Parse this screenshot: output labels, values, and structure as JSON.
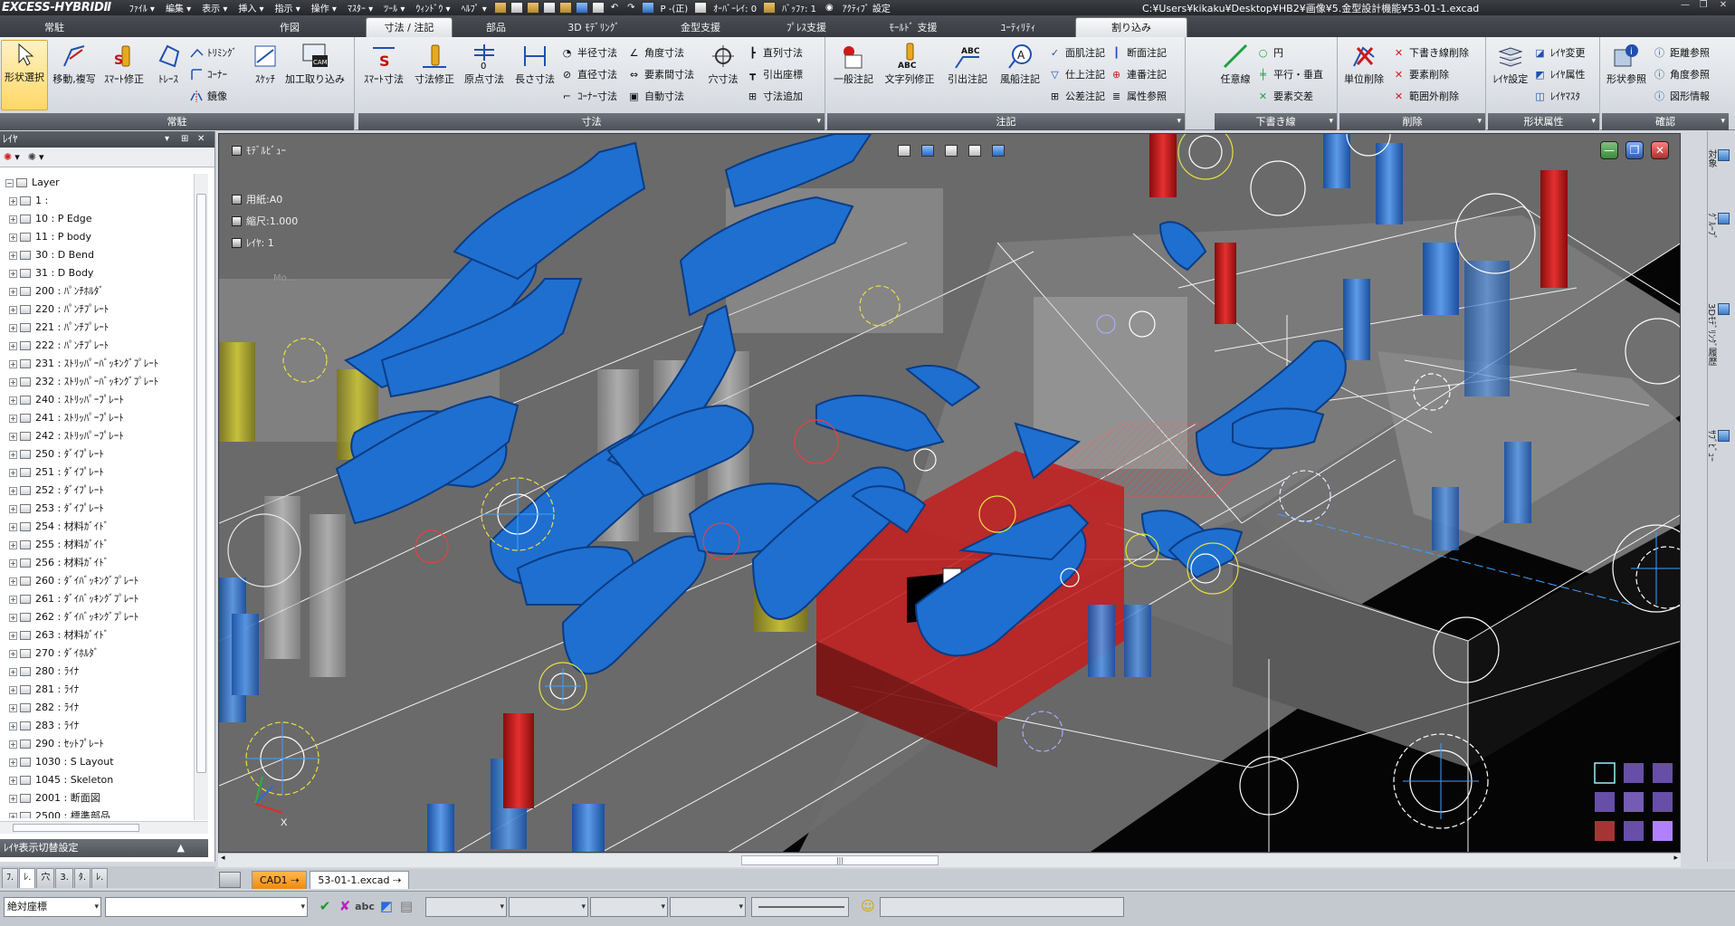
{
  "app": {
    "logo": "EXCESS-HYBRIDⅡ",
    "file_path": "C:¥Users¥kikaku¥Desktop¥HB2¥画像¥5.金型設計機能¥53-01-1.excad"
  },
  "menu": [
    "ﾌｧｲﾙ ▾",
    "編集 ▾",
    "表示 ▾",
    "挿入 ▾",
    "指示 ▾",
    "操作 ▾",
    "ﾏｽﾀｰ ▾",
    "ﾂｰﾙ ▾",
    "ｳｨﾝﾄﾞｳ ▾",
    "ﾍﾙﾌﾟ ▾"
  ],
  "quick": {
    "p_label": "P -(正)",
    "overlay": "ｵｰﾊﾞｰﾚｲ: 0",
    "buffer": "ﾊﾞｯﾌｧ: 1",
    "active": "ｱｸﾃｨﾌﾞ 設定"
  },
  "tabs": [
    "常駐",
    "作図",
    "寸法 / 注記",
    "部品",
    "3D ﾓﾃﾞﾘﾝｸﾞ",
    "金型支援",
    "ﾌﾟﾚｽ支援",
    "ﾓｰﾙﾄﾞ 支援",
    "ﾕｰﾃｨﾘﾃｨ",
    "割り込み"
  ],
  "ribbon": {
    "jochu": {
      "label": "常駐",
      "select": "形状選択",
      "move": "移動,複写",
      "smart_edit": "ｽﾏｰﾄ修正",
      "trace": "ﾄﾚｰｽ",
      "trim": "ﾄﾘﾐﾝｸﾞ",
      "corner": "ｺｰﾅｰ",
      "mirror": "鏡像",
      "sketch": "ｽｹｯﾁ",
      "cam": "加工取り込み"
    },
    "sunpo": {
      "label": "寸法",
      "smart": "ｽﾏｰﾄ寸法",
      "edit": "寸法修正",
      "origin": "原点寸法",
      "length": "長さ寸法",
      "radius": "半径寸法",
      "diameter": "直径寸法",
      "corner": "ｺｰﾅｰ寸法",
      "angle": "角度寸法",
      "between": "要素間寸法",
      "auto": "自動寸法",
      "hole": "穴寸法",
      "series": "直列寸法",
      "coord": "引出座標",
      "add": "寸法追加"
    },
    "chuki": {
      "label": "注記",
      "general": "一般注記",
      "text_edit": "文字列修正",
      "leader": "引出注記",
      "balloon": "風船注記",
      "surface": "面肌注記",
      "finish": "仕上注記",
      "tolerance": "公差注記",
      "section": "断面注記",
      "serial": "連番注記",
      "attr": "属性参照"
    },
    "shita": {
      "label": "下書き線",
      "any": "任意線",
      "circle": "円",
      "parallel": "平行・垂直",
      "cross": "要素交差"
    },
    "sakujo": {
      "label": "削除",
      "unit": "単位削除",
      "draft_del": "下書き線削除",
      "elem_del": "要素削除",
      "range_del": "範囲外削除"
    },
    "keijo": {
      "label": "形状属性",
      "layer_set": "ﾚｲﾔ設定",
      "layer_change": "ﾚｲﾔ変更",
      "layer_attr": "ﾚｲﾔ属性",
      "layer_master": "ﾚｲﾔﾏｽﾀ"
    },
    "kakunin": {
      "label": "確認",
      "shape_ref": "形状参照",
      "dist": "距離参照",
      "angle": "角度参照",
      "shape_info": "図形情報"
    }
  },
  "layer_panel": {
    "title": "ﾚｲﾔ",
    "pin": "▾ ✦ ✕",
    "foot": "ﾚｲﾔ表示切替設定",
    "items": [
      "Layer",
      "1 :",
      "10 : P Edge",
      "11 : P body",
      "30 : D Bend",
      "31 : D Body",
      "200 : ﾊﾟﾝﾁﾎﾙﾀﾞ",
      "220 : ﾊﾟﾝﾁﾌﾟﾚｰﾄ",
      "221 : ﾊﾟﾝﾁﾌﾟﾚｰﾄ",
      "222 : ﾊﾟﾝﾁﾌﾟﾚｰﾄ",
      "231 : ｽﾄﾘｯﾊﾟｰﾊﾞｯｷﾝｸﾞﾌﾟﾚｰﾄ",
      "232 : ｽﾄﾘｯﾊﾟｰﾊﾞｯｷﾝｸﾞﾌﾟﾚｰﾄ",
      "240 : ｽﾄﾘｯﾊﾟｰﾌﾟﾚｰﾄ",
      "241 : ｽﾄﾘｯﾊﾟｰﾌﾟﾚｰﾄ",
      "242 : ｽﾄﾘｯﾊﾟｰﾌﾟﾚｰﾄ",
      "250 : ﾀﾞｲﾌﾟﾚｰﾄ",
      "251 : ﾀﾞｲﾌﾟﾚｰﾄ",
      "252 : ﾀﾞｲﾌﾟﾚｰﾄ",
      "253 : ﾀﾞｲﾌﾟﾚｰﾄ",
      "254 : 材料ｶﾞｲﾄﾞ",
      "255 : 材料ｶﾞｲﾄﾞ",
      "256 : 材料ｶﾞｲﾄﾞ",
      "260 : ﾀﾞｲﾊﾞｯｷﾝｸﾞﾌﾟﾚｰﾄ",
      "261 : ﾀﾞｲﾊﾞｯｷﾝｸﾞﾌﾟﾚｰﾄ",
      "262 : ﾀﾞｲﾊﾞｯｷﾝｸﾞﾌﾟﾚｰﾄ",
      "263 : 材料ｶﾞｲﾄﾞ",
      "270 : ﾀﾞｲﾎﾙﾀﾞ",
      "280 : ﾗｲﾅ",
      "281 : ﾗｲﾅ",
      "282 : ﾗｲﾅ",
      "283 : ﾗｲﾅ",
      "290 : ｾｯﾄﾌﾟﾚｰﾄ",
      "1030 : S Layout",
      "1045 : Skeleton",
      "2001 : 断面図",
      "2500 : 標準部品"
    ],
    "tabs": [
      "ﾌ.",
      "ﾚ.",
      "穴",
      "3.",
      "ﾀ.",
      "ﾚ."
    ]
  },
  "viewport": {
    "model_view": "ﾓﾃﾞﾙﾋﾞｭｰ",
    "paper": "用紙:A0",
    "scale": "縮尺:1.000",
    "layer": "ﾚｲﾔ: 1",
    "faint": "Mo..."
  },
  "side_strip": [
    "対象",
    "ｸﾞﾙｰﾌﾟ",
    "3Dﾓﾃﾞﾘﾝｸﾞ履歴",
    "ｻﾌﾞﾋﾞｭｰ"
  ],
  "doc_tabs": [
    "CAD1",
    "53-01-1.excad"
  ],
  "status": {
    "coord_mode": "絶対座標",
    "command_input": ""
  },
  "colors": {
    "accent_tab": "#f08a10",
    "model_blue": "#1e6fd0",
    "model_red": "#c41c1c",
    "model_yellow": "#d8d020",
    "selection": "#ffd766"
  }
}
